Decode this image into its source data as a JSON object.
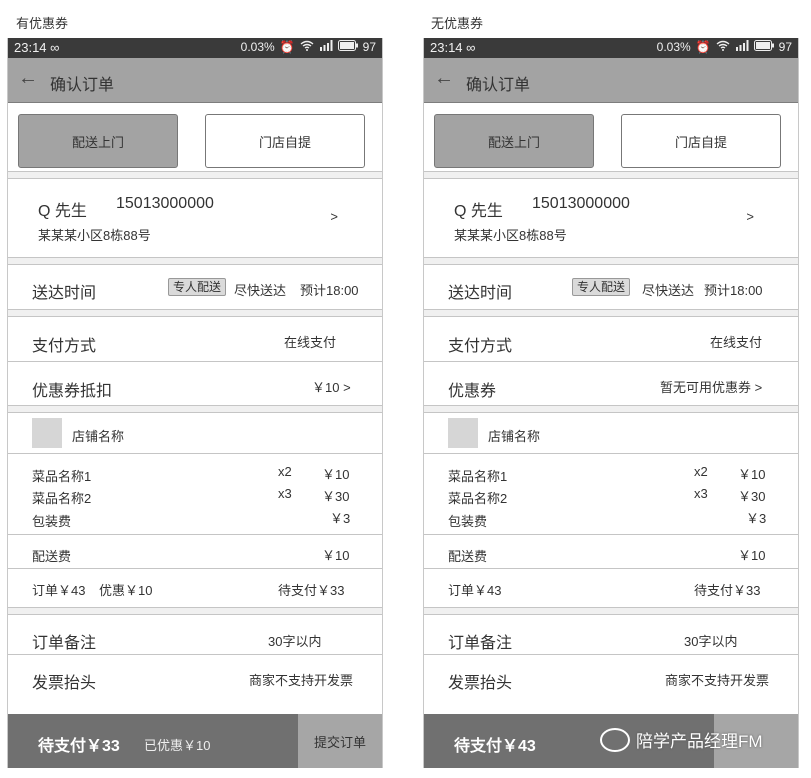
{
  "screens": [
    {
      "caption": "有优惠券",
      "status": {
        "time": "23:14 ∞",
        "network": "0.03%",
        "battery": "97"
      },
      "nav": {
        "back": "←",
        "title": "确认订单"
      },
      "delivery": {
        "selected": "配送上门",
        "other": "门店自提"
      },
      "address": {
        "name": "Q 先生",
        "phone": "15013000000",
        "street": "某某某小区8栋88号",
        "chevron": ">"
      },
      "time_row": {
        "label": "送达时间",
        "tag": "专人配送",
        "speed": "尽快送达",
        "eta": "预计18:00"
      },
      "pay_row": {
        "label": "支付方式",
        "value": "在线支付"
      },
      "coupon_row": {
        "label": "优惠券抵扣",
        "value": "￥10 >"
      },
      "shop": {
        "name": "店铺名称"
      },
      "items": [
        {
          "name": "菜品名称1",
          "qty": "x2",
          "price": "￥10"
        },
        {
          "name": "菜品名称2",
          "qty": "x3",
          "price": "￥30"
        },
        {
          "name": "包装费",
          "qty": "",
          "price": "￥3"
        }
      ],
      "delivery_fee": {
        "label": "配送费",
        "value": "￥10"
      },
      "summary": {
        "order": "订单￥43",
        "discount": "优惠￥10",
        "due": "待支付￥33"
      },
      "note_row": {
        "label": "订单备注",
        "value": "30字以内"
      },
      "invoice_row": {
        "label": "发票抬头",
        "value": "商家不支持开发票"
      },
      "bottom": {
        "pay": "待支付￥33",
        "saved": "已优惠￥10",
        "submit": "提交订单"
      }
    },
    {
      "caption": "无优惠券",
      "status": {
        "time": "23:14 ∞",
        "network": "0.03%",
        "battery": "97"
      },
      "nav": {
        "back": "←",
        "title": "确认订单"
      },
      "delivery": {
        "selected": "配送上门",
        "other": "门店自提"
      },
      "address": {
        "name": "Q 先生",
        "phone": "15013000000",
        "street": "某某某小区8栋88号",
        "chevron": ">"
      },
      "time_row": {
        "label": "送达时间",
        "tag": "专人配送",
        "speed": "尽快送达",
        "eta": "预计18:00"
      },
      "pay_row": {
        "label": "支付方式",
        "value": "在线支付"
      },
      "coupon_row": {
        "label": "优惠券",
        "value": "暂无可用优惠券 >"
      },
      "shop": {
        "name": "店铺名称"
      },
      "items": [
        {
          "name": "菜品名称1",
          "qty": "x2",
          "price": "￥10"
        },
        {
          "name": "菜品名称2",
          "qty": "x3",
          "price": "￥30"
        },
        {
          "name": "包装费",
          "qty": "",
          "price": "￥3"
        }
      ],
      "delivery_fee": {
        "label": "配送费",
        "value": "￥10"
      },
      "summary": {
        "order": "订单￥43",
        "discount": "",
        "due": "待支付￥33"
      },
      "note_row": {
        "label": "订单备注",
        "value": "30字以内"
      },
      "invoice_row": {
        "label": "发票抬头",
        "value": "商家不支持开发票"
      },
      "bottom": {
        "pay": "待支付￥43",
        "saved": "",
        "submit": ""
      }
    }
  ],
  "watermark": "陪学产品经理FM"
}
